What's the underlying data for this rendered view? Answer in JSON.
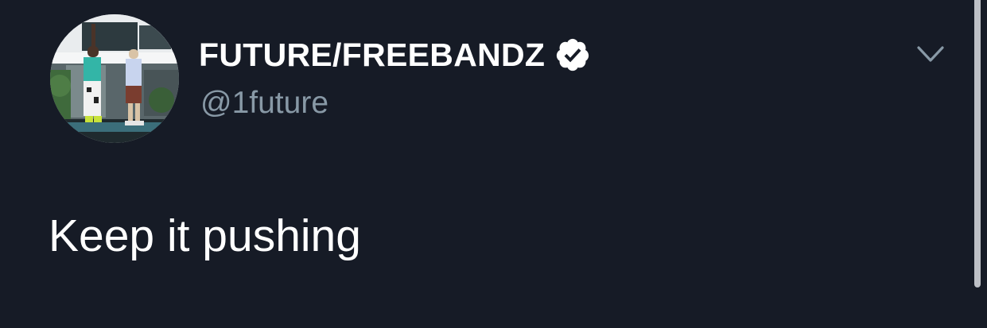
{
  "tweet": {
    "display_name": "FUTURE/FREEBANDZ",
    "handle": "@1future",
    "text": "Keep it pushing",
    "verified": true
  },
  "icons": {
    "verified": "verified-badge-icon",
    "menu": "chevron-down-icon"
  },
  "colors": {
    "background": "#161b26",
    "name": "#ffffff",
    "handle": "#8899a6",
    "text": "#ffffff",
    "caret": "#8899a6"
  }
}
